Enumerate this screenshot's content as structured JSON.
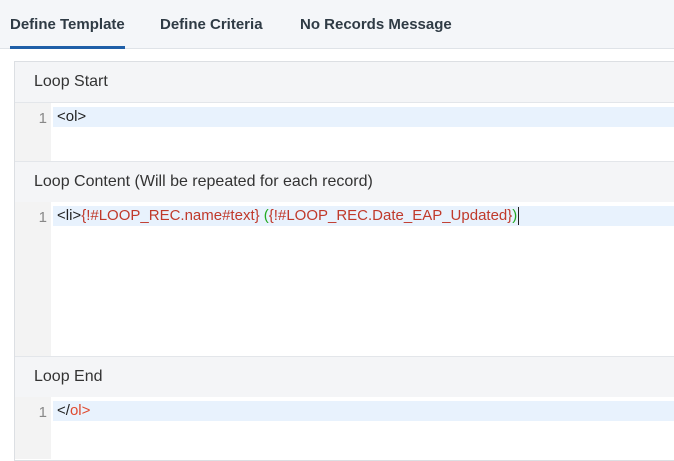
{
  "tabs": [
    {
      "label": "Define Template",
      "active": true
    },
    {
      "label": "Define Criteria",
      "active": false
    },
    {
      "label": "No Records Message",
      "active": false
    }
  ],
  "sections": {
    "loop_start": {
      "title": "Loop Start",
      "line_number": "1",
      "code": "<ol>"
    },
    "loop_content": {
      "title": "Loop Content (Will be repeated for each record)",
      "line_number": "1",
      "tag": "<li>",
      "merge1": "{!#LOOP_REC.name#text}",
      "space": " ",
      "paren_open": "(",
      "merge2": "{!#LOOP_REC.Date_EAP_Updated}",
      "paren_close": ")"
    },
    "loop_end": {
      "title": "Loop End",
      "line_number": "1",
      "tag_open": "</",
      "tag_name": "ol",
      "tag_close": ">"
    }
  },
  "colors": {
    "active_tab_underline": "#1f5fa8",
    "merge_field": "#c0392b",
    "paren": "#22aa22",
    "line_highlight": "#e8f2fd"
  }
}
